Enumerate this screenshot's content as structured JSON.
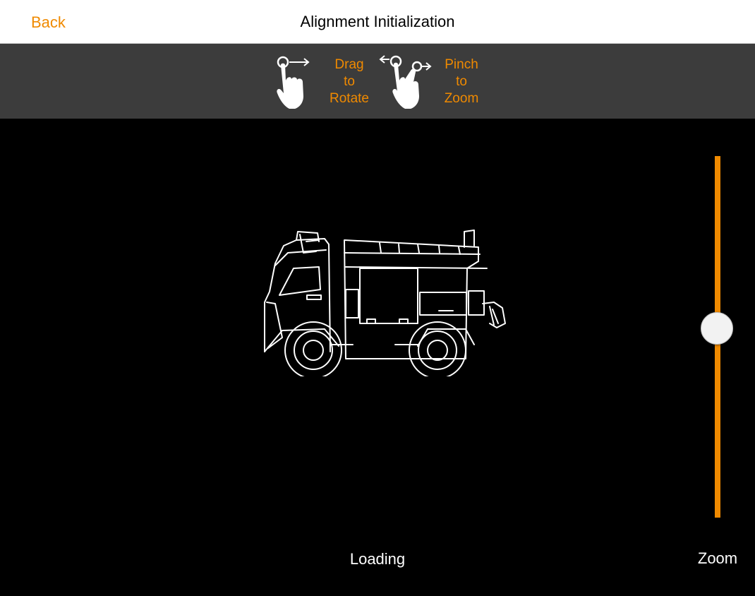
{
  "navbar": {
    "back_label": "Back",
    "title": "Alignment Initialization"
  },
  "hints": {
    "rotate": {
      "line1": "Drag",
      "line2": "to",
      "line3": "Rotate",
      "icon": "drag-hand-icon"
    },
    "zoom": {
      "line1": "Pinch",
      "line2": "to",
      "line3": "Zoom",
      "icon": "pinch-hand-icon"
    }
  },
  "viewport": {
    "model": "fire-truck-wireframe",
    "status": "Loading"
  },
  "zoom_slider": {
    "label": "Zoom",
    "level": 0.5
  },
  "colors": {
    "accent": "#f08a00",
    "hint_bar": "#3c3c3c",
    "background": "#000000"
  }
}
